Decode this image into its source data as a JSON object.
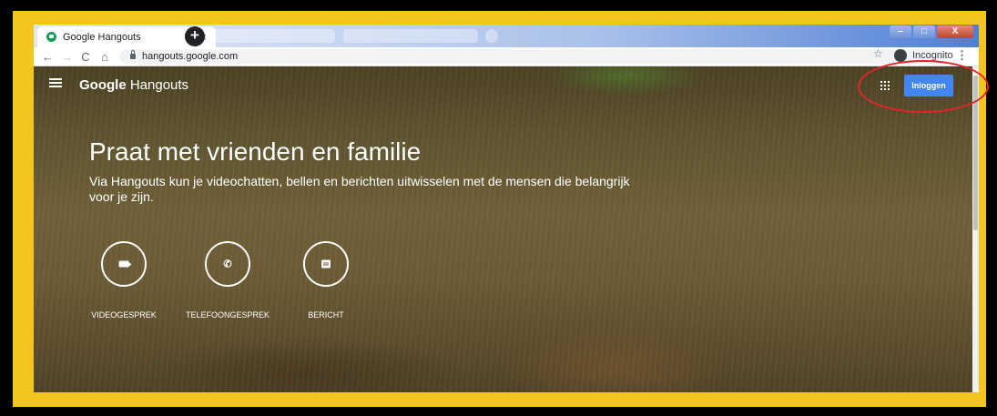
{
  "browser": {
    "tab_title": "Google Hangouts",
    "tab_close": "×",
    "new_tab": "+",
    "url": "hangouts.google.com",
    "profile_label": "Incognito",
    "window_minimize": "–",
    "window_maximize": "□",
    "window_close": "X"
  },
  "header": {
    "brand_google": "Google",
    "brand_product": "Hangouts",
    "signin_label": "Inloggen"
  },
  "hero": {
    "title": "Praat met vrienden en familie",
    "subtitle": "Via Hangouts kun je videochatten, bellen en berichten uitwisselen met de mensen die belangrijk voor je zijn.",
    "actions": [
      {
        "label": "VIDEOGESPREK",
        "icon": "video-icon"
      },
      {
        "label": "TELEFOONGESPREK",
        "icon": "phone-icon"
      },
      {
        "label": "BERICHT",
        "icon": "message-icon"
      }
    ]
  },
  "colors": {
    "signin": "#4285f4",
    "annotation": "#e3242b",
    "frame": "#f4c51c"
  }
}
